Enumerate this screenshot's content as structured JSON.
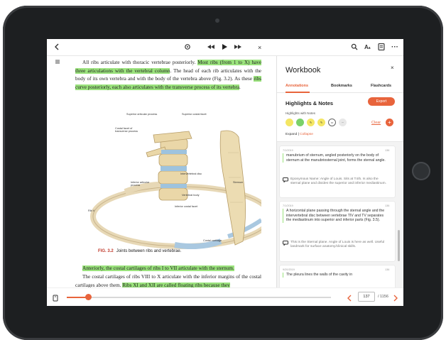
{
  "toolbar": {
    "back_icon": "chevron-left-icon",
    "settings_icon": "gear-icon",
    "rewind_icon": "rewind-icon",
    "play_icon": "play-icon",
    "fastforward_icon": "fast-forward-icon",
    "close_audio": "×",
    "search_icon": "search-icon",
    "font_label": "A",
    "more_label": "···"
  },
  "reader": {
    "para1_pre": "All ribs articulate with thoracic vertebrae posteriorly. ",
    "para1_hl1": "Most ribs (from 1 to X) have three articulations with the vertebral column",
    "para1_mid": ". The head of each rib articulates with the body of its own vertebra and with the body of the vertebra above (Fig. 3.2). As these ",
    "para1_hl2": "ribs curve posteriorly, each also articulates with the transverse process of its vertebra",
    "para1_end": ".",
    "para2_hl": "Anteriorly, the costal cartilages of ribs I to VII articulate with the sternum.",
    "para3_pre": "The costal cartilages of ribs VIII to X articulate with the inferior margins of the costal cartilages above them. ",
    "para3_hl": "Ribs XI and XII are called floating ribs because they",
    "figure_labels": {
      "superior_articular": "Superior articular process",
      "superior_costal": "Superior costal facet",
      "costal_facet_tp": "Costal facet of transverse process",
      "intervertebral": "Intervertebral disc",
      "inferior_articular": "Inferior articular process",
      "vertebral_body": "Vertebral body",
      "sternum": "Sternum",
      "inferior_costal": "Inferior costal facet",
      "rib_v": "Rib V",
      "costal_cartilage": "Costal cartilage"
    },
    "caption_num": "FIG. 3.2",
    "caption_text": "Joints between ribs and vertebrae."
  },
  "bottom": {
    "progress": 0.08,
    "page": "137",
    "total": "/ 1156"
  },
  "workbook": {
    "title": "Workbook",
    "close": "×",
    "tabs": [
      "Annotations",
      "Bookmarks",
      "Flashcards"
    ],
    "section_title": "Highlights & Notes",
    "export_label": "Export",
    "filter_label": "Highlights with Notes",
    "clear_label": "Clear",
    "expand_label": "Expand",
    "collapse_label": "Collapse",
    "cards": [
      {
        "date": "7/1/2019",
        "page": "136",
        "quote": "manubrium of sternum, angled posteriorly on the body of sternum at the manubriosternal joint, forms the sternal angle.",
        "note": "Eponymous Name: Angle of Louis. Sits at T4/5. Is also the sternal plane and divides the superior and inferior mediastinum."
      },
      {
        "date": "7/1/2019",
        "page": "136",
        "quote": "A horizontal plane passing through the sternal angle and the intervertebral disc between vertebrae TIV and TV separates the mediastinum into superior and inferior parts (Fig. 3.5).",
        "note": "This is the Sternal plane. Angle of Louis is here as well. Useful landmark for surface anatomy/clinical skills."
      },
      {
        "date": "9/20/2019",
        "page": "136",
        "quote": "The pleura lines the walls of the cavity in",
        "note": ""
      }
    ]
  },
  "colors": {
    "accent": "#e8643c",
    "highlight": "#9be37d",
    "yellow": "#f4e664",
    "green": "#7bd16a"
  }
}
